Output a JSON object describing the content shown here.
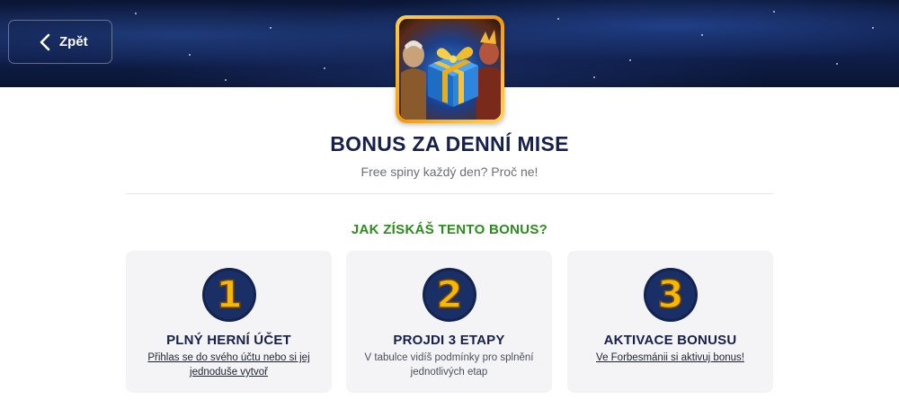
{
  "header": {
    "back_label": "Zpět"
  },
  "bonus": {
    "title": "BONUS ZA DENNÍ MISE",
    "subtitle": "Free spiny každý den? Proč ne!"
  },
  "how": {
    "heading": "JAK ZÍSKÁŠ TENTO BONUS?",
    "steps": [
      {
        "number": "1",
        "title": "PLNÝ HERNÍ ÚČET",
        "text": "Přihlas se do svého účtu nebo si jej jednoduše vytvoř"
      },
      {
        "number": "2",
        "title": "PROJDI 3 ETAPY",
        "text": "V tabulce vidíš podmínky pro splnění jednotlivých etap"
      },
      {
        "number": "3",
        "title": "AKTIVACE BONUSU",
        "text": "Ve Forbesmánii si aktivuj bonus!"
      }
    ]
  },
  "colors": {
    "title": "#17204a",
    "accent_green": "#2d8a1f",
    "number_gold": "#f6b800",
    "number_circle": "#13234f"
  }
}
